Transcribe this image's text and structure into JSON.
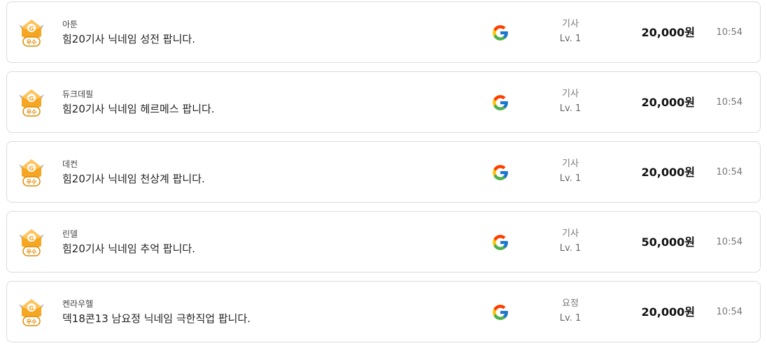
{
  "listings": [
    {
      "seller": "아툰",
      "title": "힘20기사 닉네임 성전 팝니다.",
      "server": "기사",
      "level": "Lv. 1",
      "price": "20,000원",
      "time": "10:54",
      "badge": "우수",
      "platform_icon": "google-icon"
    },
    {
      "seller": "듀크데필",
      "title": "힘20기사 닉네임 헤르메스 팝니다.",
      "server": "기사",
      "level": "Lv. 1",
      "price": "20,000원",
      "time": "10:54",
      "badge": "우수",
      "platform_icon": "google-icon"
    },
    {
      "seller": "데컨",
      "title": "힘20기사 닉네임 천상계 팝니다.",
      "server": "기사",
      "level": "Lv. 1",
      "price": "20,000원",
      "time": "10:54",
      "badge": "우수",
      "platform_icon": "google-icon"
    },
    {
      "seller": "린델",
      "title": "힘20기사 닉네임 추억 팝니다.",
      "server": "기사",
      "level": "Lv. 1",
      "price": "50,000원",
      "time": "10:54",
      "badge": "우수",
      "platform_icon": "google-icon"
    },
    {
      "seller": "켄라우헬",
      "title": "덱18콘13 남요정 닉네임 극한직업 팝니다.",
      "server": "요정",
      "level": "Lv. 1",
      "price": "20,000원",
      "time": "10:54",
      "badge": "우수",
      "platform_icon": "google-icon"
    }
  ],
  "colors": {
    "badge_orange": "#f5a623",
    "badge_dark": "#e08a00",
    "google_blue": "#4285F4",
    "google_red": "#EA4335",
    "google_yellow": "#FBBC05",
    "google_green": "#34A853"
  }
}
